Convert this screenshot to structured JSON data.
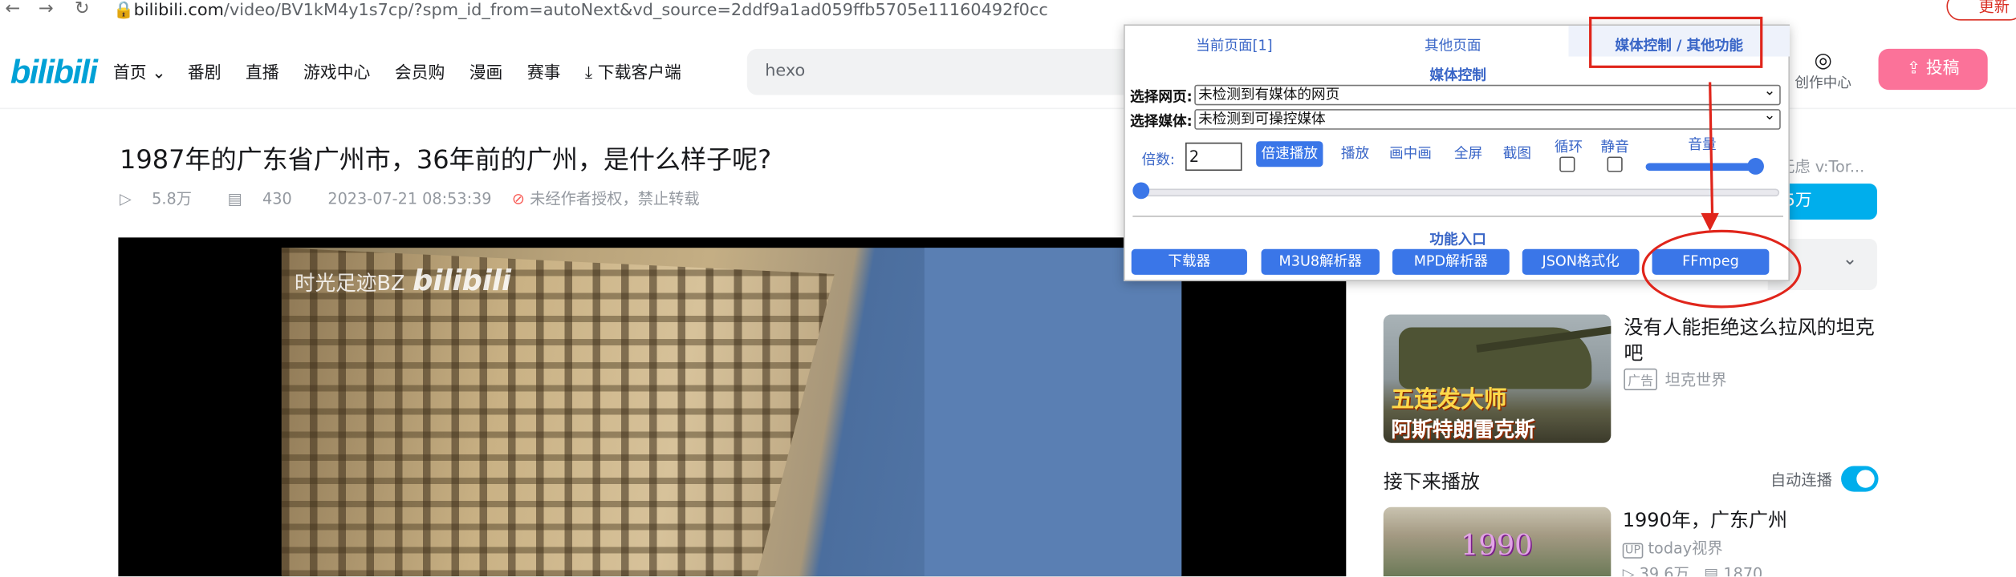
{
  "browser": {
    "url_host": "bilibili.com",
    "url_path": "/video/BV1kM4y1s7cp/?spm_id_from=autoNext&vd_source=2ddf9a1ad059ffb5705e11160492f0cc",
    "update_label": "更新",
    "ext_badge": "1"
  },
  "header": {
    "logo": "bilibili",
    "nav": [
      "首页",
      "番剧",
      "直播",
      "游戏中心",
      "会员购",
      "漫画",
      "赛事",
      "下载客户端"
    ],
    "search_value": "hexo",
    "creator_label": "创作中心",
    "post_label": "投稿"
  },
  "video": {
    "title": "1987年的广东省广州市，36年前的广州，是什么样子呢?",
    "views": "5.8万",
    "danmaku": "430",
    "date": "2023-07-21 08:53:39",
    "copyright": "未经作者授权，禁止转载",
    "watermark": "时光足迹BZ",
    "watermark_logo": "bilibili"
  },
  "sidebar": {
    "uploader_tail": "无虑 v:Tor...",
    "follow_tail": "5万",
    "ad": {
      "title": "没有人能拒绝这么拉风的坦克吧",
      "tag": "广告",
      "source": "坦克世界",
      "line1": "五连发大师",
      "line2": "阿斯特朗雷克斯"
    },
    "next_header": "接下来播放",
    "autoplay_label": "自动连播",
    "rec": {
      "title": "1990年，广东广州",
      "uploader": "today视界",
      "views": "39.6万",
      "danmaku": "1870",
      "thumb_text": "1990"
    }
  },
  "popup": {
    "tabs": [
      "当前页面[1]",
      "其他页面",
      "媒体控制 / 其他功能"
    ],
    "media_section": "媒体控制",
    "select_page_label": "选择网页:",
    "select_page_value": "未检测到有媒体的网页",
    "select_media_label": "选择媒体:",
    "select_media_value": "未检测到可操控媒体",
    "rate_label": "倍数:",
    "rate_value": "2",
    "buttons": [
      "倍速播放",
      "播放",
      "画中画",
      "全屏",
      "截图"
    ],
    "loop_label": "循环",
    "mute_label": "静音",
    "volume_label": "音量",
    "volume_level": 1.0,
    "progress_level": 0.0,
    "func_section": "功能入口",
    "func_buttons": [
      "下载器",
      "M3U8解析器",
      "MPD解析器",
      "JSON格式化",
      "FFmpeg"
    ]
  },
  "colors": {
    "bili_blue": "#00a1d6",
    "bili_pink": "#fb7299",
    "popup_blue": "#3a76e8",
    "annotation_red": "#e0251b"
  }
}
